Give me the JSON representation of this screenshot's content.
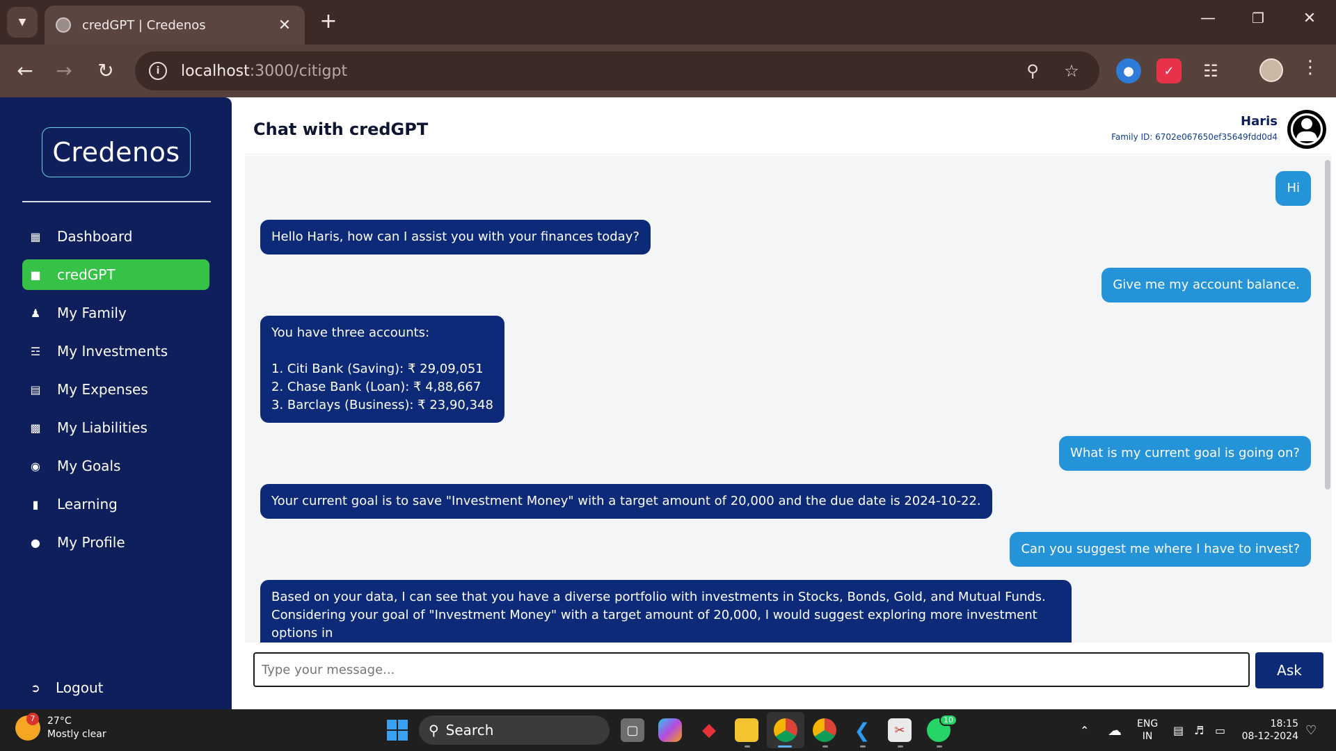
{
  "browser": {
    "tab_title": "credGPT | Credenos",
    "url_host": "localhost",
    "url_path": ":3000/citigpt"
  },
  "app": {
    "logo": "Credenos",
    "nav": [
      {
        "label": "Dashboard",
        "icon": "dashboard-icon",
        "active": false
      },
      {
        "label": "credGPT",
        "icon": "robot-icon",
        "active": true
      },
      {
        "label": "My Family",
        "icon": "family-icon",
        "active": false
      },
      {
        "label": "My Investments",
        "icon": "database-icon",
        "active": false
      },
      {
        "label": "My Expenses",
        "icon": "receipt-icon",
        "active": false
      },
      {
        "label": "My Liabilities",
        "icon": "money-bill-icon",
        "active": false
      },
      {
        "label": "My Goals",
        "icon": "target-icon",
        "active": false
      },
      {
        "label": "Learning",
        "icon": "book-icon",
        "active": false
      },
      {
        "label": "My Profile",
        "icon": "user-circle-icon",
        "active": false
      }
    ],
    "logout_label": "Logout",
    "accent_color": "#36c246",
    "sidebar_color": "#0f1f5c"
  },
  "chat": {
    "title": "Chat with credGPT",
    "user_name": "Haris",
    "family_id": "Family ID: 6702e067650ef35649fdd0d4",
    "messages": [
      {
        "role": "user",
        "text": "Hi"
      },
      {
        "role": "bot",
        "text": "Hello Haris, how can I assist you with your finances today?"
      },
      {
        "role": "user",
        "text": "Give me my account balance."
      },
      {
        "role": "bot",
        "text": "You have three accounts:\n\n1. Citi Bank (Saving): ₹ 29,09,051\n2. Chase Bank (Loan): ₹ 4,88,667\n3. Barclays (Business): ₹ 23,90,348"
      },
      {
        "role": "user",
        "text": "What is my current goal is going on?"
      },
      {
        "role": "bot",
        "text": "Your current goal is to save \"Investment Money\" with a target amount of 20,000 and the due date is 2024-10-22."
      },
      {
        "role": "user",
        "text": "Can you suggest me where I have to invest?"
      },
      {
        "role": "bot",
        "text": "Based on your data, I can see that you have a diverse portfolio with investments in Stocks, Bonds, Gold, and Mutual Funds.\nConsidering your goal of \"Investment Money\" with a target amount of 20,000, I would suggest exploring more investment options in\nStocks or Mutual Funds."
      }
    ],
    "input_placeholder": "Type your message...",
    "ask_label": "Ask"
  },
  "taskbar": {
    "temperature": "27°C",
    "weather": "Mostly clear",
    "weather_badge": "7",
    "search_label": "Search",
    "whatsapp_badge": "10",
    "lang_line1": "ENG",
    "lang_line2": "IN",
    "time": "18:15",
    "date": "08-12-2024"
  }
}
